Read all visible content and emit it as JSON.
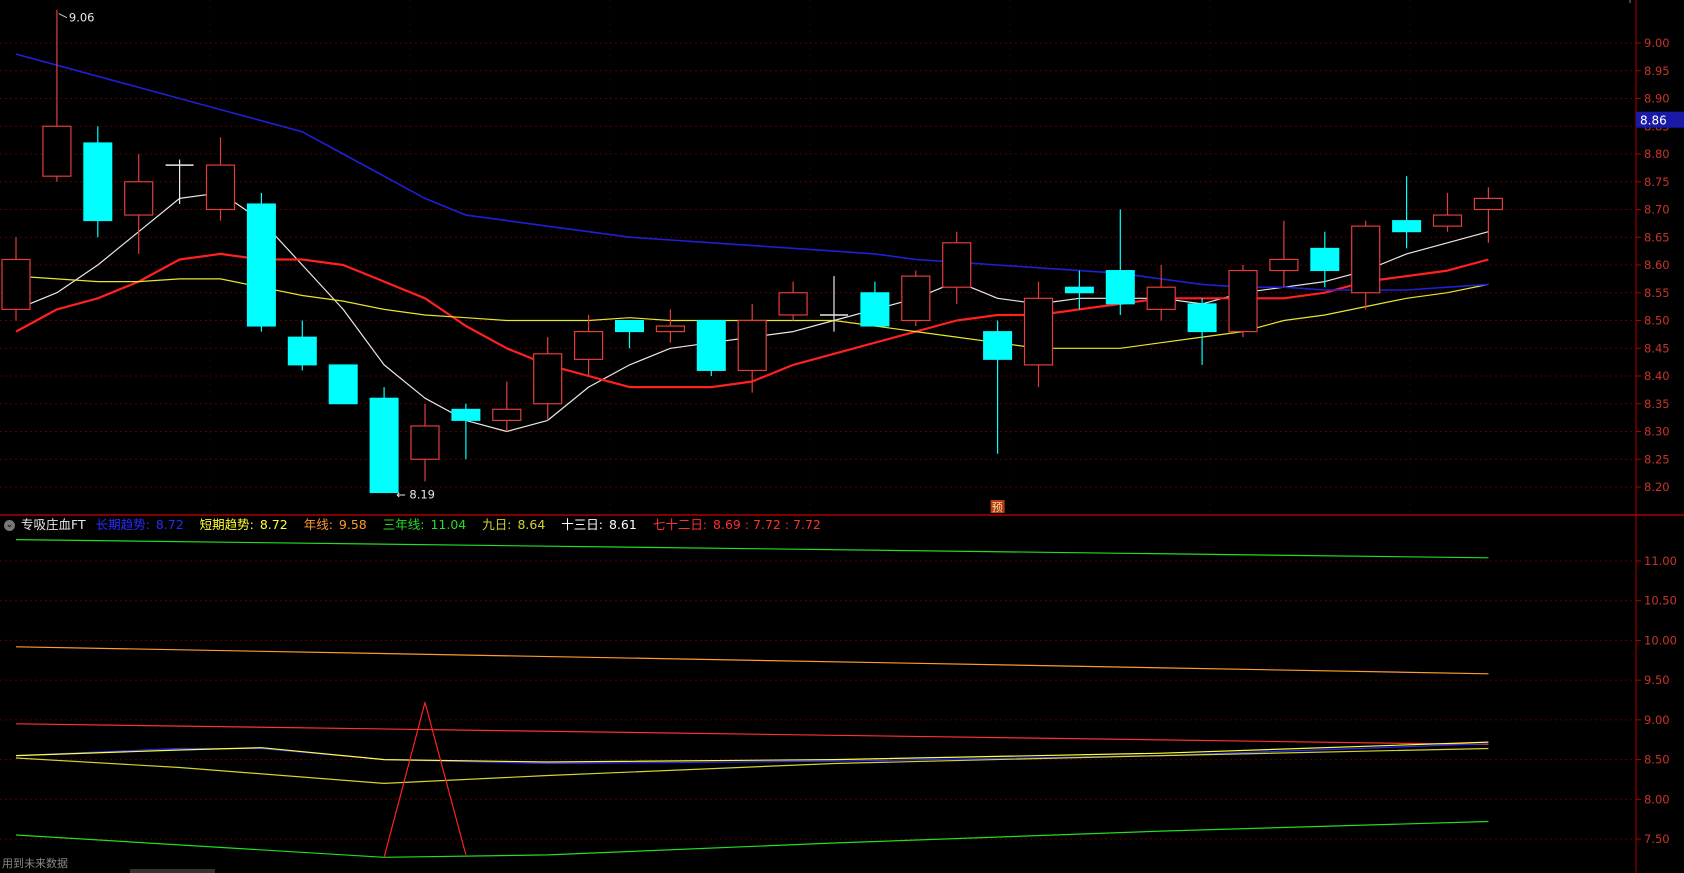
{
  "colors": {
    "background": "#000000",
    "grid": "#5a0000",
    "axis": "#b00000",
    "up": "#e23c3c",
    "down": "#00ffff",
    "ma5": "#e8e8e8",
    "ma10": "#ff2020",
    "ma20": "#e6e62e",
    "ma60": "#1f1fd6",
    "long_trend": "#2a2aff",
    "short_trend": "#ffff33",
    "year": "#ff9a2e",
    "three_year": "#22dd22",
    "nine_day": "#d2d232",
    "thirteen_day": "#ffffff",
    "seventy_two": "#ff3030",
    "spike_line": "#ff2020"
  },
  "chart_data": [
    {
      "type": "candlestick",
      "ylim": [
        8.17,
        9.12
      ],
      "y_ticks": [
        "9.00",
        "8.95",
        "8.90",
        "8.85",
        "8.80",
        "8.75",
        "8.70",
        "8.65",
        "8.60",
        "8.55",
        "8.50",
        "8.45",
        "8.40",
        "8.35",
        "8.30",
        "8.25",
        "8.20"
      ],
      "price_label": "8.86",
      "high_annotation": "9.06",
      "low_annotation": "8.19",
      "forecast_marker": "预",
      "candles": [
        {
          "o": 8.52,
          "c": 8.61,
          "h": 8.65,
          "l": 8.5
        },
        {
          "o": 8.76,
          "c": 8.85,
          "h": 9.06,
          "l": 8.75
        },
        {
          "o": 8.82,
          "c": 8.68,
          "h": 8.85,
          "l": 8.65
        },
        {
          "o": 8.69,
          "c": 8.75,
          "h": 8.8,
          "l": 8.62
        },
        {
          "o": 8.78,
          "c": 8.78,
          "h": 8.79,
          "l": 8.71
        },
        {
          "o": 8.7,
          "c": 8.78,
          "h": 8.83,
          "l": 8.68
        },
        {
          "o": 8.71,
          "c": 8.49,
          "h": 8.73,
          "l": 8.48
        },
        {
          "o": 8.47,
          "c": 8.42,
          "h": 8.5,
          "l": 8.41
        },
        {
          "o": 8.42,
          "c": 8.35,
          "h": 8.42,
          "l": 8.35
        },
        {
          "o": 8.36,
          "c": 8.19,
          "h": 8.38,
          "l": 8.19
        },
        {
          "o": 8.25,
          "c": 8.31,
          "h": 8.35,
          "l": 8.21
        },
        {
          "o": 8.34,
          "c": 8.32,
          "h": 8.35,
          "l": 8.25
        },
        {
          "o": 8.32,
          "c": 8.34,
          "h": 8.39,
          "l": 8.3
        },
        {
          "o": 8.35,
          "c": 8.44,
          "h": 8.47,
          "l": 8.32
        },
        {
          "o": 8.43,
          "c": 8.48,
          "h": 8.51,
          "l": 8.4
        },
        {
          "o": 8.5,
          "c": 8.48,
          "h": 8.5,
          "l": 8.45
        },
        {
          "o": 8.48,
          "c": 8.49,
          "h": 8.52,
          "l": 8.46
        },
        {
          "o": 8.5,
          "c": 8.41,
          "h": 8.5,
          "l": 8.4
        },
        {
          "o": 8.41,
          "c": 8.5,
          "h": 8.53,
          "l": 8.37
        },
        {
          "o": 8.51,
          "c": 8.55,
          "h": 8.57,
          "l": 8.5
        },
        {
          "o": 8.51,
          "c": 8.51,
          "h": 8.58,
          "l": 8.48
        },
        {
          "o": 8.55,
          "c": 8.49,
          "h": 8.57,
          "l": 8.49
        },
        {
          "o": 8.5,
          "c": 8.58,
          "h": 8.59,
          "l": 8.49
        },
        {
          "o": 8.56,
          "c": 8.64,
          "h": 8.66,
          "l": 8.53
        },
        {
          "o": 8.48,
          "c": 8.43,
          "h": 8.5,
          "l": 8.26
        },
        {
          "o": 8.42,
          "c": 8.54,
          "h": 8.57,
          "l": 8.38
        },
        {
          "o": 8.56,
          "c": 8.55,
          "h": 8.59,
          "l": 8.52
        },
        {
          "o": 8.59,
          "c": 8.53,
          "h": 8.7,
          "l": 8.51
        },
        {
          "o": 8.52,
          "c": 8.56,
          "h": 8.6,
          "l": 8.5
        },
        {
          "o": 8.53,
          "c": 8.48,
          "h": 8.54,
          "l": 8.42
        },
        {
          "o": 8.48,
          "c": 8.59,
          "h": 8.6,
          "l": 8.47
        },
        {
          "o": 8.59,
          "c": 8.61,
          "h": 8.68,
          "l": 8.56
        },
        {
          "o": 8.63,
          "c": 8.59,
          "h": 8.66,
          "l": 8.56
        },
        {
          "o": 8.55,
          "c": 8.67,
          "h": 8.68,
          "l": 8.52
        },
        {
          "o": 8.68,
          "c": 8.66,
          "h": 8.76,
          "l": 8.63
        },
        {
          "o": 8.67,
          "c": 8.69,
          "h": 8.73,
          "l": 8.66
        },
        {
          "o": 8.7,
          "c": 8.72,
          "h": 8.74,
          "l": 8.64
        }
      ],
      "series": [
        {
          "key": "ma5",
          "values": [
            8.52,
            8.55,
            8.6,
            8.66,
            8.72,
            8.73,
            8.68,
            8.6,
            8.52,
            8.42,
            8.36,
            8.32,
            8.3,
            8.32,
            8.38,
            8.42,
            8.45,
            8.46,
            8.47,
            8.48,
            8.5,
            8.52,
            8.54,
            8.57,
            8.54,
            8.53,
            8.54,
            8.54,
            8.54,
            8.53,
            8.55,
            8.56,
            8.57,
            8.59,
            8.62,
            8.64,
            8.66
          ]
        },
        {
          "key": "ma10",
          "values": [
            8.48,
            8.52,
            8.54,
            8.57,
            8.61,
            8.62,
            8.61,
            8.61,
            8.6,
            8.57,
            8.54,
            8.49,
            8.45,
            8.42,
            8.4,
            8.38,
            8.38,
            8.38,
            8.39,
            8.42,
            8.44,
            8.46,
            8.48,
            8.5,
            8.51,
            8.51,
            8.52,
            8.53,
            8.54,
            8.54,
            8.54,
            8.54,
            8.55,
            8.57,
            8.58,
            8.59,
            8.61
          ]
        },
        {
          "key": "ma20",
          "values": [
            8.58,
            8.575,
            8.57,
            8.57,
            8.575,
            8.575,
            8.56,
            8.545,
            8.535,
            8.52,
            8.51,
            8.505,
            8.5,
            8.5,
            8.5,
            8.505,
            8.5,
            8.5,
            8.5,
            8.5,
            8.5,
            8.49,
            8.48,
            8.47,
            8.46,
            8.45,
            8.45,
            8.45,
            8.46,
            8.47,
            8.48,
            8.5,
            8.51,
            8.525,
            8.54,
            8.55,
            8.565
          ]
        },
        {
          "key": "ma60",
          "values": [
            8.98,
            8.96,
            8.94,
            8.92,
            8.9,
            8.88,
            8.86,
            8.84,
            8.8,
            8.76,
            8.72,
            8.69,
            8.68,
            8.67,
            8.66,
            8.65,
            8.645,
            8.64,
            8.635,
            8.63,
            8.625,
            8.62,
            8.61,
            8.605,
            8.6,
            8.595,
            8.59,
            8.585,
            8.575,
            8.565,
            8.56,
            8.56,
            8.555,
            8.555,
            8.555,
            8.56,
            8.565
          ]
        }
      ]
    },
    {
      "type": "line",
      "title": "专吸庄血FT",
      "ylim": [
        7.25,
        11.35
      ],
      "y_ticks": [
        "11.00",
        "10.50",
        "10.00",
        "9.50",
        "9.00",
        "8.50",
        "8.00",
        "7.50"
      ],
      "legend": [
        {
          "key": "long_trend",
          "label": "长期趋势:",
          "value": "8.72"
        },
        {
          "key": "short_trend",
          "label": "短期趋势:",
          "value": "8.72"
        },
        {
          "key": "year",
          "label": "年线:",
          "value": "9.58"
        },
        {
          "key": "three_year",
          "label": "三年线:",
          "value": "11.04"
        },
        {
          "key": "nine_day",
          "label": "九日:",
          "value": "8.64"
        },
        {
          "key": "thirteen_day",
          "label": "十三日:",
          "value": "8.61"
        },
        {
          "key": "seventy_two",
          "label": "七十二日:",
          "value": "8.69 : 7.72 : 7.72"
        }
      ],
      "series": [
        {
          "key": "three_year",
          "x": [
            0,
            36
          ],
          "values": [
            11.27,
            11.04
          ]
        },
        {
          "key": "year",
          "x": [
            0,
            36
          ],
          "values": [
            9.92,
            9.58
          ]
        },
        {
          "key": "seventy_two",
          "x": [
            0,
            36
          ],
          "values": [
            8.95,
            8.69
          ]
        },
        {
          "key": "long_trend",
          "x": [
            0,
            4,
            6,
            9,
            13,
            20,
            28,
            36
          ],
          "values": [
            8.55,
            8.64,
            8.64,
            8.5,
            8.45,
            8.48,
            8.55,
            8.7
          ]
        },
        {
          "key": "short_trend",
          "x": [
            0,
            4,
            6,
            9,
            13,
            20,
            28,
            36
          ],
          "values": [
            8.55,
            8.62,
            8.65,
            8.5,
            8.47,
            8.5,
            8.58,
            8.72
          ]
        },
        {
          "key": "nine_day",
          "x": [
            0,
            4,
            9,
            13,
            20,
            28,
            36
          ],
          "values": [
            8.52,
            8.4,
            8.2,
            8.3,
            8.45,
            8.55,
            8.64
          ]
        },
        {
          "key": "three_year_low",
          "color": "three_year",
          "x": [
            0,
            9,
            13,
            20,
            28,
            36
          ],
          "values": [
            7.55,
            7.27,
            7.3,
            7.45,
            7.6,
            7.72
          ]
        },
        {
          "key": "spike",
          "color": "spike_line",
          "x": [
            9,
            10,
            11
          ],
          "values": [
            7.27,
            9.22,
            7.3
          ]
        }
      ]
    }
  ],
  "footer_note": "用到未来数据"
}
